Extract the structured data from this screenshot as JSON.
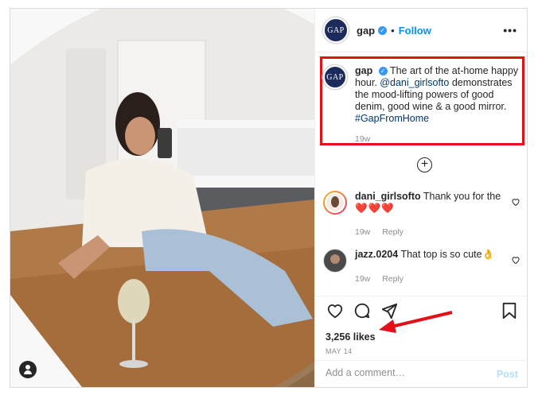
{
  "header": {
    "avatar_text": "GAP",
    "username": "gap",
    "separator": "•",
    "follow_label": "Follow",
    "more_label": "•••"
  },
  "caption": {
    "avatar_text": "GAP",
    "username": "gap",
    "text_part1": "The art of the at-home happy hour.",
    "mention": "@dani_girlsofto",
    "text_part2": "demonstrates the mood-lifting powers of good denim, good wine & a good mirror.",
    "hashtag": "#GapFromHome",
    "time": "19w"
  },
  "load_more_label": "+",
  "comments": [
    {
      "username": "dani_girlsofto",
      "text": "Thank you for the",
      "emoji": "❤️❤️❤️",
      "time": "19w",
      "reply": "Reply"
    },
    {
      "username": "jazz.0204",
      "text": "That top is so cute",
      "emoji": "👌",
      "time": "19w",
      "reply": "Reply"
    }
  ],
  "engagement": {
    "likes": "3,256 likes",
    "date": "MAY 14"
  },
  "add_comment": {
    "placeholder": "Add a comment…",
    "post_label": "Post"
  },
  "colors": {
    "follow": "#0095f6",
    "annotation_red": "#e3101a",
    "gap_navy": "#1d2a5c"
  },
  "icons": [
    "heart-icon",
    "comment-icon",
    "share-icon",
    "bookmark-icon",
    "add-comments-icon",
    "user-tag-icon",
    "verified-badge-icon"
  ]
}
